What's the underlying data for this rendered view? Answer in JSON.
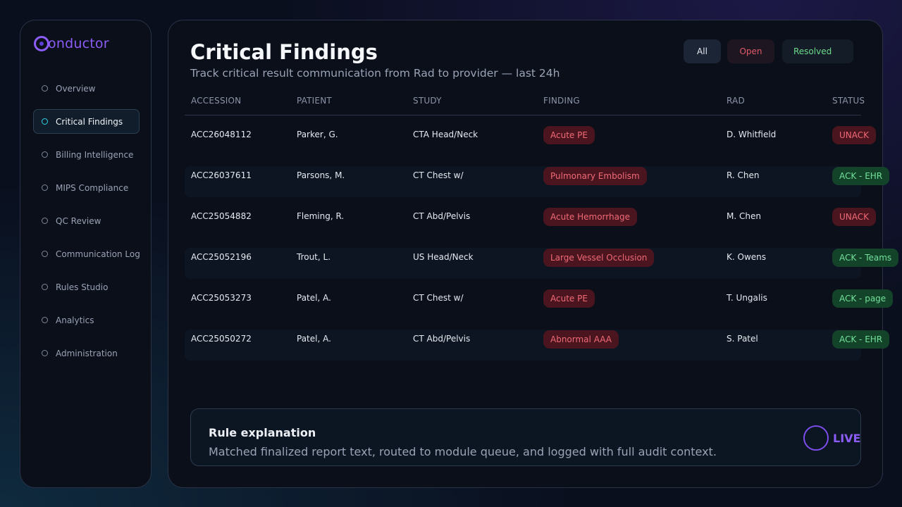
{
  "brand": {
    "logo_text": "onductor"
  },
  "sidebar": {
    "items": [
      {
        "label": "Overview",
        "active": false
      },
      {
        "label": "Critical Findings",
        "active": true
      },
      {
        "label": "Billing Intelligence",
        "active": false
      },
      {
        "label": "MIPS Compliance",
        "active": false
      },
      {
        "label": "QC Review",
        "active": false
      },
      {
        "label": "Communication Log",
        "active": false
      },
      {
        "label": "Rules Studio",
        "active": false
      },
      {
        "label": "Analytics",
        "active": false
      },
      {
        "label": "Administration",
        "active": false
      }
    ]
  },
  "page": {
    "title": "Critical Findings",
    "subtitle": "Track critical result communication from Rad to provider — last 24h"
  },
  "filters": {
    "all": "All",
    "open": "Open",
    "resolved": "Resolved"
  },
  "table": {
    "columns": {
      "accession": "ACCESSION",
      "patient": "PATIENT",
      "study": "STUDY",
      "finding": "FINDING",
      "rad": "RAD",
      "status": "STATUS"
    },
    "rows": [
      {
        "accession": "ACC26048112",
        "patient": "Parker, G.",
        "study": "CTA Head/Neck",
        "finding": "Acute PE",
        "rad": "D. Whitfield",
        "status": "UNACK"
      },
      {
        "accession": "ACC26037611",
        "patient": "Parsons, M.",
        "study": "CT Chest w/",
        "finding": "Pulmonary Embolism",
        "rad": "R. Chen",
        "status": "ACK - EHR"
      },
      {
        "accession": "ACC25054882",
        "patient": "Fleming, R.",
        "study": "CT Abd/Pelvis",
        "finding": "Acute Hemorrhage",
        "rad": "M. Chen",
        "status": "UNACK"
      },
      {
        "accession": "ACC25052196",
        "patient": "Trout, L.",
        "study": "US Head/Neck",
        "finding": "Large Vessel Occlusion",
        "rad": "K. Owens",
        "status": "ACK - Teams"
      },
      {
        "accession": "ACC25053273",
        "patient": "Patel, A.",
        "study": "CT Chest w/",
        "finding": "Acute PE",
        "rad": "T. Ungalis",
        "status": "ACK - page"
      },
      {
        "accession": "ACC25050272",
        "patient": "Patel, A.",
        "study": "CT Abd/Pelvis",
        "finding": "Abnormal AAA",
        "rad": "S. Patel",
        "status": "ACK - EHR"
      }
    ]
  },
  "rule_explanation": {
    "title": "Rule explanation",
    "text": "Matched finalized report text, routed to module queue, and logged with full audit context.",
    "live_label": "LIVE"
  },
  "colors": {
    "accent": "#8b5cf6",
    "active_dot": "#2dd4e8",
    "unack": "#f06a76",
    "ack": "#73e09a"
  }
}
